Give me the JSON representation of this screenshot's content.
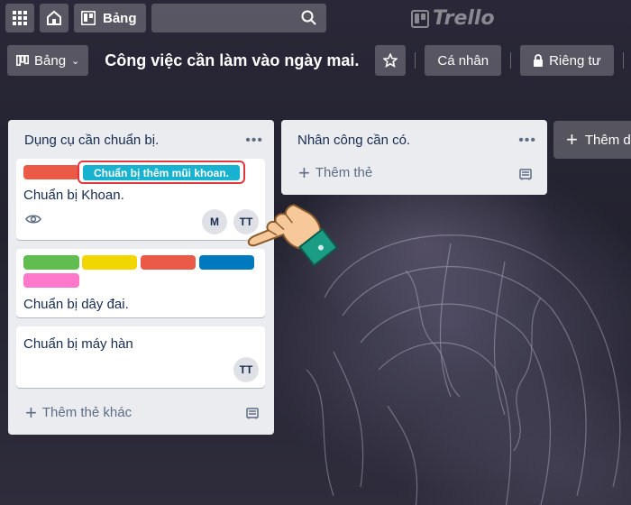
{
  "topbar": {
    "boards_label": "Bảng",
    "search_placeholder": "",
    "logo_text": "Trello"
  },
  "board": {
    "view_label": "Bảng",
    "title": "Công việc cần làm vào ngày mai.",
    "team_label": "Cá nhân",
    "visibility_label": "Riêng tư"
  },
  "lists": [
    {
      "title": "Dụng cụ cần chuẩn bị.",
      "cards": [
        {
          "text": "Chuẩn bị Khoan.",
          "labels": [
            "#eb5a46"
          ],
          "badge": "eye-icon",
          "members": [
            "M",
            "TT"
          ],
          "tooltip": "Chuẩn bị thêm mũi khoan."
        },
        {
          "text": "Chuẩn bị dây đai.",
          "labels": [
            "#61bd4f",
            "#f2d600",
            "#eb5a46",
            "#0079bf",
            "#ff78cb"
          ],
          "members": []
        },
        {
          "text": "Chuẩn bị máy hàn",
          "labels": [],
          "members": [
            "TT"
          ]
        }
      ],
      "add_label": "Thêm thẻ khác"
    },
    {
      "title": "Nhân công cần có.",
      "cards": [],
      "add_label": "Thêm thẻ"
    }
  ],
  "add_list_label": "Thêm d",
  "colors": {
    "list_bg": "#ebecf0",
    "tooltip_bg": "#17b2cf",
    "tooltip_border": "#e0383e",
    "hand_skin": "#f7c99a",
    "hand_cuff": "#1b9c85"
  }
}
